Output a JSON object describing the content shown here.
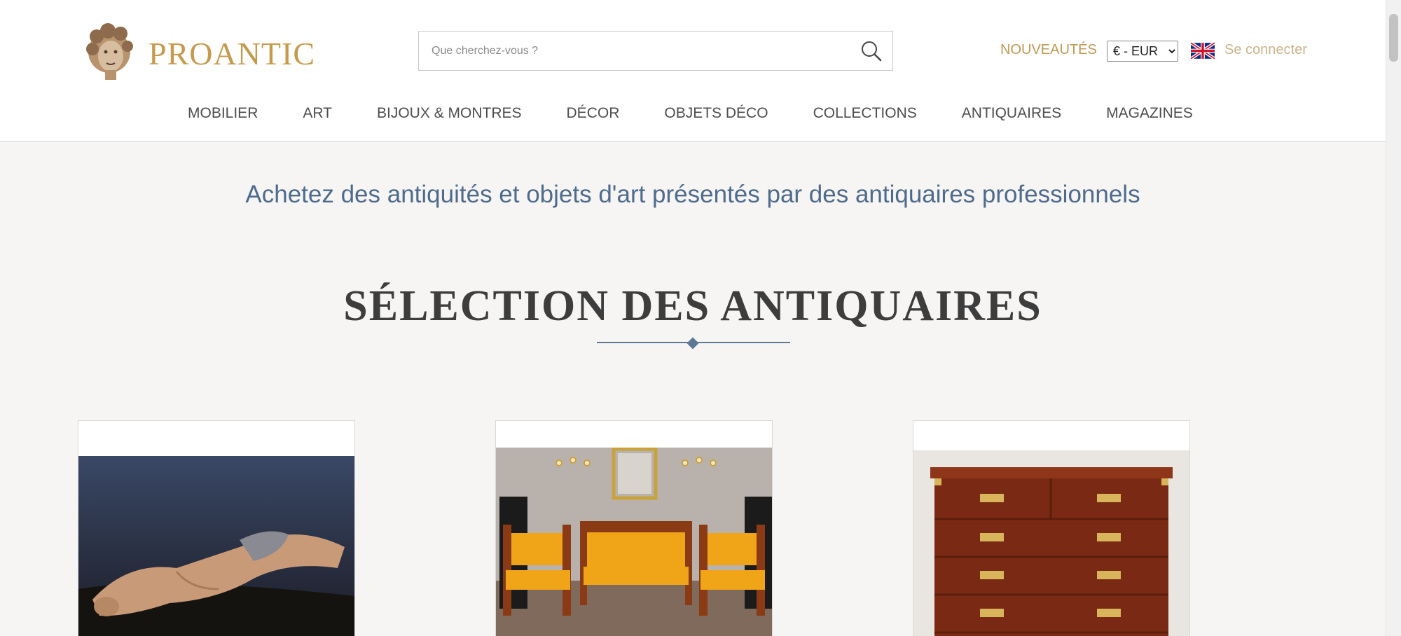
{
  "header": {
    "logo_text": "PROANTIC",
    "search_placeholder": "Que cherchez-vous ?",
    "nouveautes": "NOUVEAUTÉS",
    "currency": {
      "selected": "€ - EUR",
      "options": [
        "€ - EUR"
      ]
    },
    "login": "Se connecter"
  },
  "nav": {
    "items": [
      {
        "label": "MOBILIER"
      },
      {
        "label": "ART"
      },
      {
        "label": "BIJOUX & MONTRES"
      },
      {
        "label": "DÉCOR"
      },
      {
        "label": "OBJETS DÉCO"
      },
      {
        "label": "COLLECTIONS"
      },
      {
        "label": "ANTIQUAIRES"
      },
      {
        "label": "MAGAZINES"
      }
    ]
  },
  "main": {
    "tagline": "Achetez des antiquités et objets d'art présentés par des antiquaires professionnels",
    "section_title": "SÉLECTION DES ANTIQUAIRES"
  },
  "colors": {
    "accent_gold": "#bd9a55",
    "tagline_blue": "#4e6b8c",
    "background": "#f6f5f3"
  }
}
